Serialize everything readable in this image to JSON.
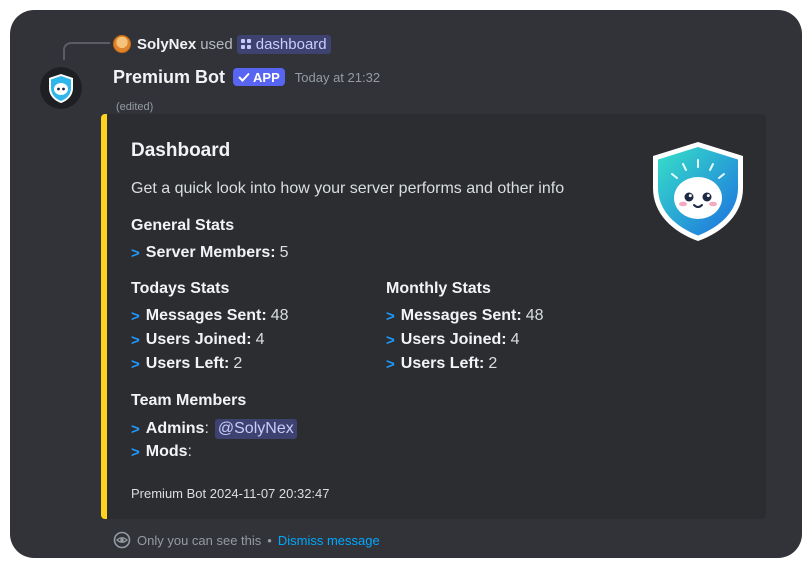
{
  "reply": {
    "user_name": "SolyNex",
    "used_text": "used",
    "command": "dashboard"
  },
  "message": {
    "author": "Premium Bot",
    "app_badge": "APP",
    "timestamp": "Today at 21:32",
    "edited": "(edited)"
  },
  "embed": {
    "accent_color": "#ffd21e",
    "title": "Dashboard",
    "description": "Get a quick look into how your server performs and other info",
    "general": {
      "heading": "General Stats",
      "items": [
        {
          "label": "Server Members:",
          "value": "5"
        }
      ]
    },
    "today": {
      "heading": "Todays Stats",
      "items": [
        {
          "label": "Messages Sent:",
          "value": "48"
        },
        {
          "label": "Users Joined:",
          "value": "4"
        },
        {
          "label": "Users Left:",
          "value": "2"
        }
      ]
    },
    "monthly": {
      "heading": "Monthly Stats",
      "items": [
        {
          "label": "Messages Sent:",
          "value": "48"
        },
        {
          "label": "Users Joined:",
          "value": "4"
        },
        {
          "label": "Users Left:",
          "value": "2"
        }
      ]
    },
    "team": {
      "heading": "Team Members",
      "admins_label": "Admins",
      "admins_mention": "@SolyNex",
      "mods_label": "Mods"
    },
    "footer": "Premium Bot 2024-11-07 20:32:47"
  },
  "ephemeral": {
    "notice": "Only you can see this",
    "separator": "•",
    "dismiss": "Dismiss message"
  },
  "icons": {
    "arrow": "chevron-right-icon",
    "eye": "eye-icon",
    "check": "check-icon",
    "command": "slash-command-icon"
  },
  "colors": {
    "link": "#00a8fc",
    "mention_bg": "#3d4270",
    "app_badge": "#5865f2"
  }
}
